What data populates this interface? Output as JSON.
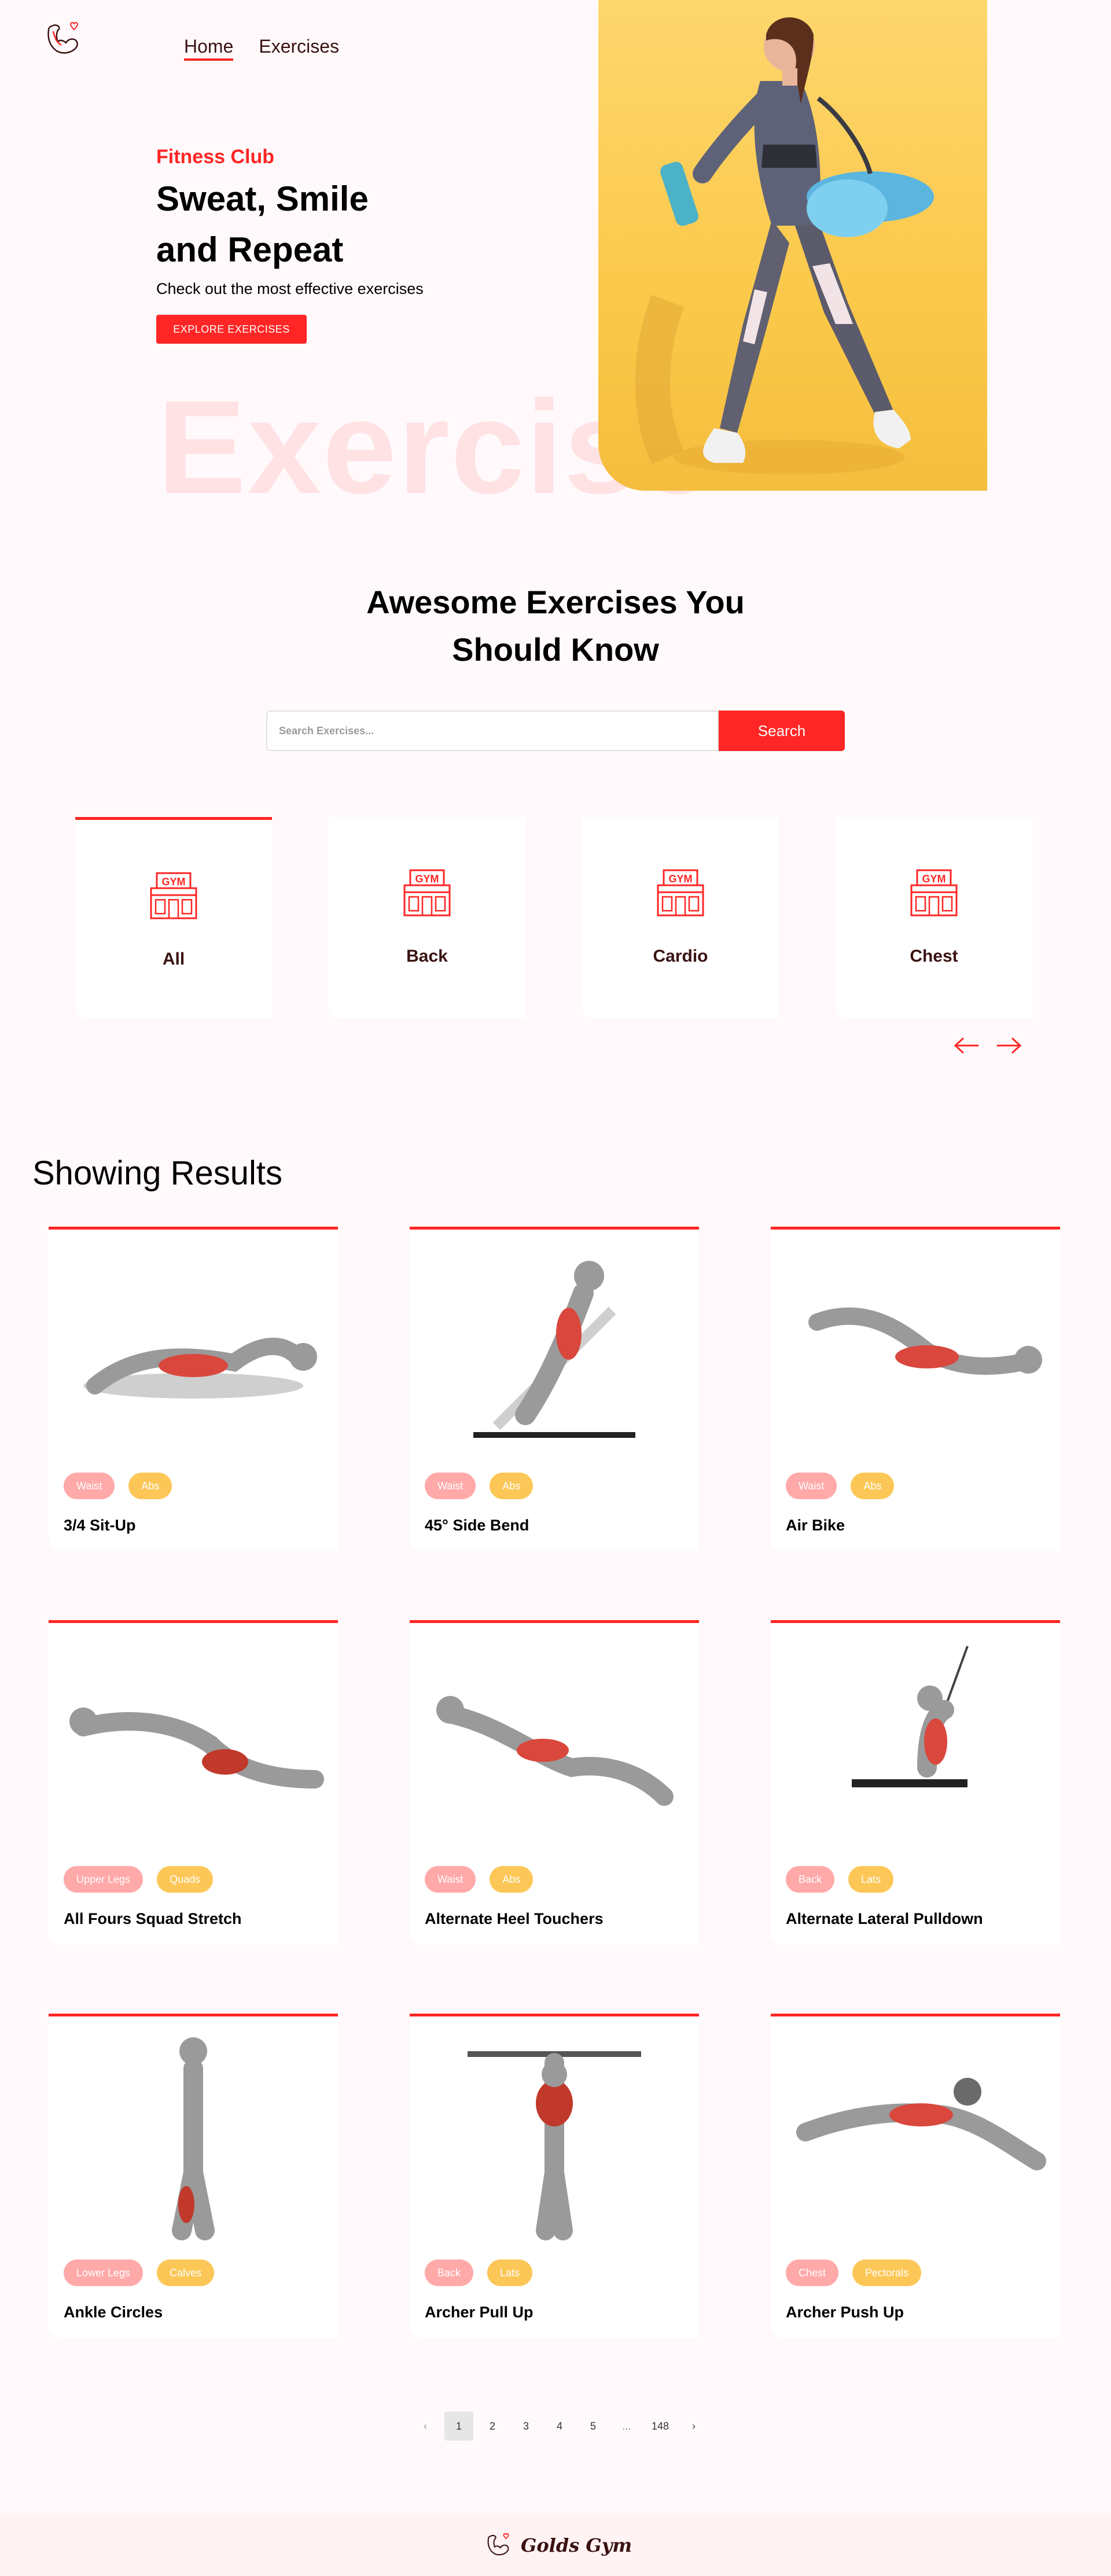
{
  "nav": {
    "logo_icon": "flexed-arm-heart-icon",
    "links": [
      "Home",
      "Exercises"
    ]
  },
  "hero": {
    "tag": "Fitness Club",
    "title_line1": "Sweat, Smile",
    "title_line2": "and Repeat",
    "subtitle": "Check out the most effective exercises",
    "button": "EXPLORE EXERCISES",
    "bg_word": "Exercise"
  },
  "search": {
    "title_line1": "Awesome Exercises You",
    "title_line2": "Should Know",
    "placeholder": "Search Exercises...",
    "button": "Search"
  },
  "categories": [
    "All",
    "Back",
    "Cardio",
    "Chest"
  ],
  "category_icon": "gym-building-icon",
  "results": {
    "title": "Showing Results",
    "cards": [
      {
        "name": "3/4 Sit-Up",
        "tags": [
          "Waist",
          "Abs"
        ]
      },
      {
        "name": "45° Side Bend",
        "tags": [
          "Waist",
          "Abs"
        ]
      },
      {
        "name": "Air Bike",
        "tags": [
          "Waist",
          "Abs"
        ]
      },
      {
        "name": "All Fours Squad Stretch",
        "tags": [
          "Upper Legs",
          "Quads"
        ]
      },
      {
        "name": "Alternate Heel Touchers",
        "tags": [
          "Waist",
          "Abs"
        ]
      },
      {
        "name": "Alternate Lateral Pulldown",
        "tags": [
          "Back",
          "Lats"
        ]
      },
      {
        "name": "Ankle Circles",
        "tags": [
          "Lower Legs",
          "Calves"
        ]
      },
      {
        "name": "Archer Pull Up",
        "tags": [
          "Back",
          "Lats"
        ]
      },
      {
        "name": "Archer Push Up",
        "tags": [
          "Chest",
          "Pectorals"
        ]
      }
    ]
  },
  "pagination": {
    "prev": "‹",
    "pages": [
      "1",
      "2",
      "3",
      "4",
      "5"
    ],
    "ellipsis": "...",
    "last": "148",
    "next": "›",
    "current": "1"
  },
  "footer": {
    "brand": "Golds Gym"
  },
  "colors": {
    "accent": "#ff2625",
    "badge_primary": "#ffa9a9",
    "badge_secondary": "#fcc757",
    "background": "#fff9fb",
    "hero_banner": "#fbc94a"
  }
}
